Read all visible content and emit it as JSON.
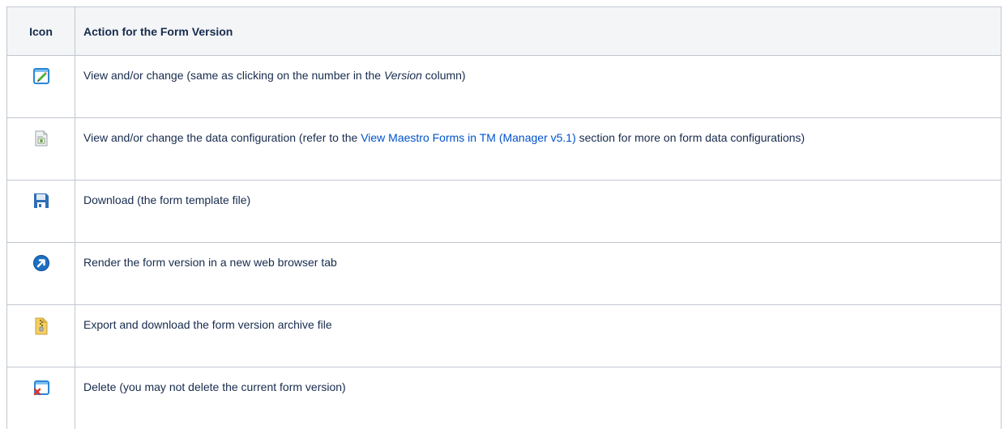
{
  "table": {
    "headers": {
      "icon": "Icon",
      "action": "Action for the Form Version"
    },
    "rows": [
      {
        "icon": "edit-pencil-icon",
        "text_before": "View and/or change (same as clicking on the number in the ",
        "text_emphasis": "Version",
        "text_after": " column)"
      },
      {
        "icon": "data-configuration-icon",
        "text_before": "View and/or change the data configuration (refer to the ",
        "link_text": "View Maestro Forms in TM (Manager v5.1)",
        "text_after": " section for more on form data configurations)"
      },
      {
        "icon": "floppy-disk-save-icon",
        "text": "Download (the form template file)"
      },
      {
        "icon": "open-arrow-icon",
        "text": "Render the form version in a new web browser tab"
      },
      {
        "icon": "zip-archive-icon",
        "text": "Export and download the form version archive file"
      },
      {
        "icon": "delete-window-icon",
        "text": "Delete (you may not delete the current form version)"
      }
    ]
  },
  "colors": {
    "link": "#0052cc",
    "header_background": "#f4f5f7",
    "border": "#c1c7d0",
    "text": "#172b4d"
  }
}
